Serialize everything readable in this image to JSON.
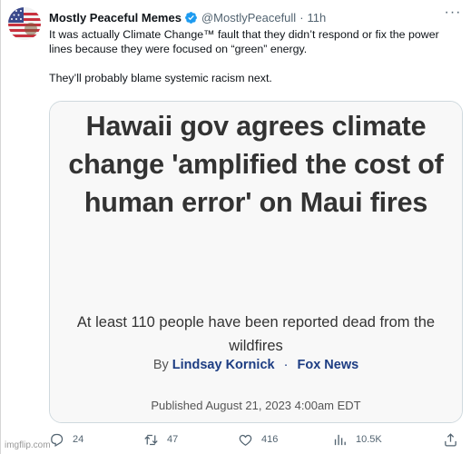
{
  "tweet": {
    "display_name": "Mostly Peaceful Memes",
    "handle": "@MostlyPeacefull",
    "separator": "·",
    "time": "11h",
    "more_label": "···",
    "text_line1": "It was actually Climate Change™ fault that they didn’t respond or fix the power lines because they were focused on “green” energy.",
    "text_line2": "They’ll probably blame systemic racism next."
  },
  "card": {
    "headline": "Hawaii gov agrees climate change 'amplified the cost of human error' on Maui fires",
    "subheadline": "At least 110 people have been reported dead from the wildfires",
    "by_label": "By",
    "author": "Lindsay Kornick",
    "source_sep": "·",
    "source": "Fox News",
    "published": "Published August 21, 2023 4:00am EDT"
  },
  "actions": {
    "reply_count": "24",
    "retweet_count": "47",
    "like_count": "416",
    "views_count": "10.5K"
  },
  "watermark": "imgflip.com",
  "colors": {
    "verified_badge": "#1d9bf0",
    "secondary_text": "#536471",
    "byline_link": "#1d3d83",
    "card_border": "#cfd9de"
  },
  "icons": {
    "avatar": "american-flag-avatar",
    "verified": "verified-badge-icon",
    "more": "more-icon",
    "reply": "reply-icon",
    "retweet": "retweet-icon",
    "like": "like-icon",
    "views": "views-icon",
    "share": "share-icon"
  }
}
